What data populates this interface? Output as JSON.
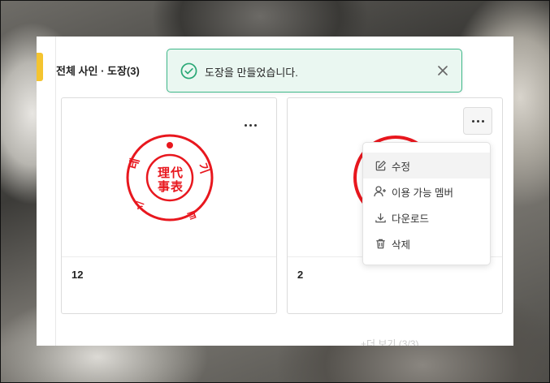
{
  "section": {
    "title": "전체 사인 · 도장(3)"
  },
  "toast": {
    "message": "도장을 만들었습니다.",
    "color": "#3fb98a"
  },
  "cards": [
    {
      "name": "12"
    },
    {
      "name": "2"
    }
  ],
  "context_menu": {
    "items": [
      {
        "label": "수정",
        "icon": "edit-icon"
      },
      {
        "label": "이용 가능 멤버",
        "icon": "add-member-icon"
      },
      {
        "label": "다운로드",
        "icon": "download-icon"
      },
      {
        "label": "삭제",
        "icon": "trash-icon"
      }
    ]
  },
  "more_link": {
    "label": "+더 보기 (3/3)"
  },
  "colors": {
    "accent": "#f4c430",
    "stamp_red": "#e8171e"
  }
}
